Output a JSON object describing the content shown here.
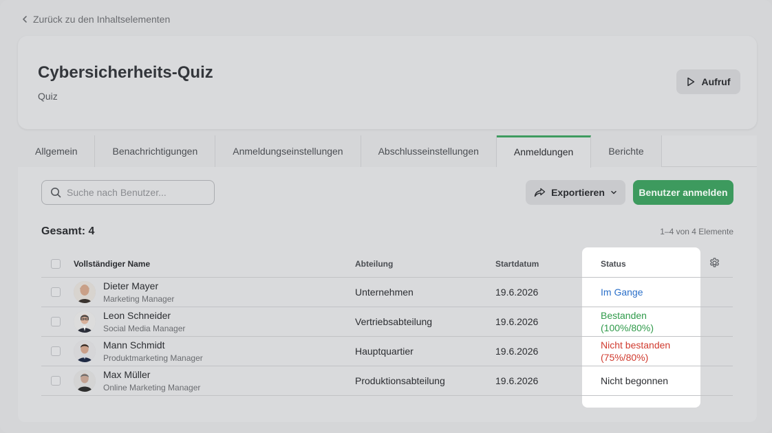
{
  "nav": {
    "back_label": "Zurück zu den Inhaltselementen"
  },
  "header": {
    "title": "Cybersicherheits-Quiz",
    "subtitle": "Quiz",
    "call_label": "Aufruf"
  },
  "tabs": [
    {
      "label": "Allgemein",
      "active": false
    },
    {
      "label": "Benachrichtigungen",
      "active": false
    },
    {
      "label": "Anmeldungseinstellungen",
      "active": false
    },
    {
      "label": "Abschlusseinstellungen",
      "active": false
    },
    {
      "label": "Anmeldungen",
      "active": true
    },
    {
      "label": "Berichte",
      "active": false
    }
  ],
  "toolbar": {
    "search_placeholder": "Suche nach Benutzer...",
    "export_label": "Exportieren",
    "enroll_label": "Benutzer anmelden"
  },
  "summary": {
    "total_label": "Gesamt: 4",
    "pagination": "1–4 von 4 Elemente"
  },
  "table": {
    "headers": {
      "name": "Vollständiger Name",
      "department": "Abteilung",
      "start_date": "Startdatum",
      "status": "Status"
    },
    "rows": [
      {
        "name": "Dieter Mayer",
        "role": "Marketing Manager",
        "department": "Unternehmen",
        "start_date": "19.6.2026",
        "status_line1": "Im Gange",
        "status_line2": "",
        "status_type": "progress"
      },
      {
        "name": "Leon Schneider",
        "role": "Social Media Manager",
        "department": "Vertriebsabteilung",
        "start_date": "19.6.2026",
        "status_line1": "Bestanden",
        "status_line2": "(100%/80%)",
        "status_type": "passed"
      },
      {
        "name": "Mann Schmidt",
        "role": "Produktmarketing Manager",
        "department": "Hauptquartier",
        "start_date": "19.6.2026",
        "status_line1": "Nicht bestanden",
        "status_line2": "(75%/80%)",
        "status_type": "failed"
      },
      {
        "name": "Max Müller",
        "role": "Online Marketing Manager",
        "department": "Produktionsabteilung",
        "start_date": "19.6.2026",
        "status_line1": "Nicht begonnen",
        "status_line2": "",
        "status_type": "none"
      }
    ]
  },
  "colors": {
    "accent_green": "#3d9a5e",
    "status_progress": "#2a6fc9",
    "status_passed": "#2f9a4a",
    "status_failed": "#d03a2e"
  },
  "icons": {
    "back": "chevron-left-icon",
    "call": "play-icon",
    "search": "search-icon",
    "export": "share-icon",
    "dropdown": "chevron-down-icon",
    "settings": "gear-icon"
  }
}
